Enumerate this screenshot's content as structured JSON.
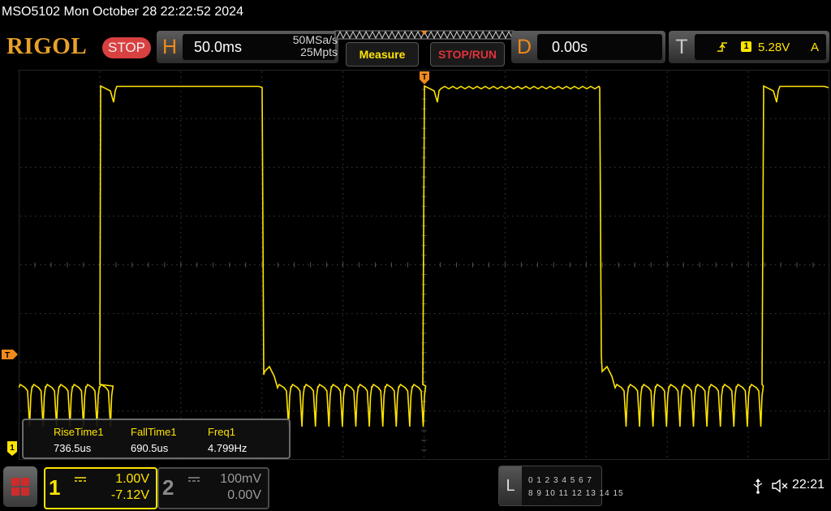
{
  "title_bar": {
    "text": "MSO5102  Mon October 28 22:22:52 2024"
  },
  "brand": {
    "logo": "RIGOL",
    "run_state": "STOP"
  },
  "horizontal": {
    "letter": "H",
    "timebase": "50.0ms",
    "sample_rate": "50MSa/s",
    "memory_depth": "25Mpts"
  },
  "buttons": {
    "measure": "Measure",
    "stop_run": "STOP/RUN"
  },
  "delay": {
    "letter": "D",
    "value": "0.00s"
  },
  "trigger": {
    "letter": "T",
    "source": "1",
    "level": "5.28V",
    "mode": "A",
    "edge_icon": "rising-edge-icon"
  },
  "markers": {
    "trigger_position": "T",
    "trigger_level": "T",
    "ch1_ground": "1"
  },
  "measurements": [
    {
      "label": "RiseTime1",
      "value": "736.5us"
    },
    {
      "label": "FallTime1",
      "value": "690.5us"
    },
    {
      "label": "Freq1",
      "value": "4.799Hz"
    }
  ],
  "channels": [
    {
      "number": "1",
      "scale": "1.00V",
      "offset": "-7.12V",
      "color": "#ffe400",
      "active": true
    },
    {
      "number": "2",
      "scale": "100mV",
      "offset": "0.00V",
      "color": "#8a8a8a",
      "active": false
    }
  ],
  "logic_analyzer": {
    "letter": "L",
    "row1": "0 1 2 3   4 5 6 7",
    "row2": "8  9 10 11 12 13 14 15"
  },
  "status": {
    "time": "22:21",
    "icons": [
      "usb-icon",
      "speaker-muted-icon",
      "menu-icon"
    ]
  },
  "colors": {
    "trace": "#ffe400",
    "accent": "#f08a1c",
    "grid": "#3a3a3a",
    "stop": "#d94040"
  }
}
